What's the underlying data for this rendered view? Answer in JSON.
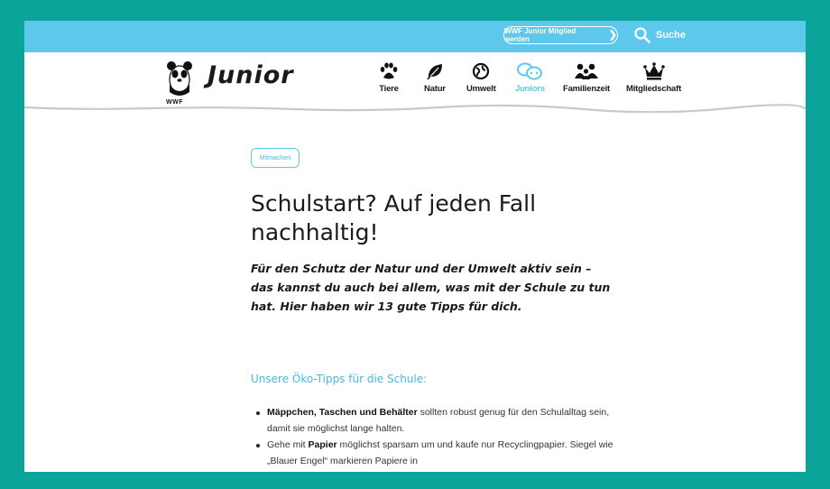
{
  "topbar": {
    "member_button": "WWF Junior Mitglied werden",
    "search_label": "Suche"
  },
  "header": {
    "logo_text": "WWF",
    "brand": "Junior",
    "nav": [
      {
        "label": "Tiere",
        "icon": "paw-icon"
      },
      {
        "label": "Natur",
        "icon": "leaf-icon"
      },
      {
        "label": "Umwelt",
        "icon": "globe-icon"
      },
      {
        "label": "Juniors",
        "icon": "chat-bubbles-icon"
      },
      {
        "label": "Familienzeit",
        "icon": "family-icon"
      },
      {
        "label": "Mitgliedschaft",
        "icon": "crown-icon"
      }
    ],
    "active_nav": "Juniors"
  },
  "article": {
    "tag": "Mitmachen",
    "title": "Schulstart? Auf jeden Fall nachhaltig!",
    "intro": "Für den Schutz der Natur und der Umwelt aktiv sein – das kannst du auch bei allem, was mit der Schule zu tun hat. Hier haben wir 13 gute Tipps für dich.",
    "section_title": "Unsere Öko-Tipps für die Schule:",
    "tips": [
      {
        "bold": "Mäppchen, Taschen und Behälter",
        "text": " sollten robust genug für den Schulalltag sein, damit sie möglichst lange halten."
      },
      {
        "pre": "Gehe mit ",
        "bold": "Papier",
        "text": " möglichst sparsam um und kaufe nur Recyclingpapier. Siegel wie „Blauer Engel“ markieren Papiere in"
      }
    ]
  },
  "colors": {
    "border": "#0aa49a",
    "topbar": "#5ec8ec",
    "accent": "#4ab7dd"
  }
}
